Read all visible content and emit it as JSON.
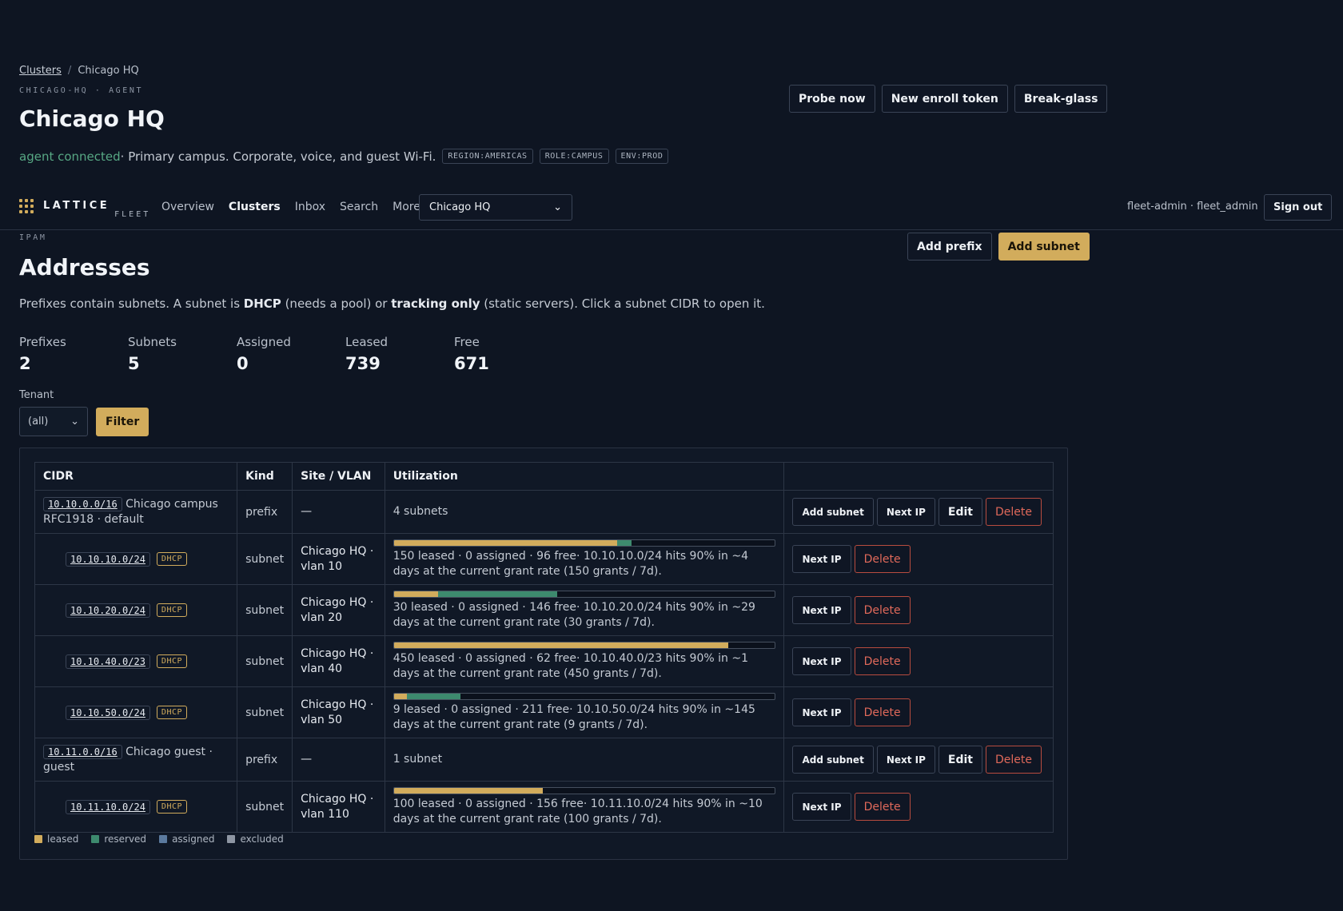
{
  "breadcrumb": {
    "root": "Clusters",
    "separator": "/",
    "current": "Chicago HQ"
  },
  "cluster": {
    "eyebrow": "CHICAGO-HQ · AGENT",
    "title": "Chicago HQ",
    "status": "agent connected",
    "description": " · Primary campus. Corporate, voice, and guest Wi-Fi.",
    "tags": [
      "REGION:AMERICAS",
      "ROLE:CAMPUS",
      "ENV:PROD"
    ],
    "actions": {
      "probe": "Probe now",
      "enroll": "New enroll token",
      "breakglass": "Break-glass"
    }
  },
  "nav": {
    "brand": "LATTICE",
    "brand_sub": "FLEET",
    "links": [
      "Overview",
      "Clusters",
      "Inbox",
      "Search",
      "More"
    ],
    "active_link": "Clusters",
    "cluster_select": "Chicago HQ",
    "user": "fleet-admin · fleet_admin",
    "signout": "Sign out"
  },
  "ipam": {
    "eyebrow": "IPAM",
    "title": "Addresses",
    "add_prefix": "Add prefix",
    "add_subnet": "Add subnet",
    "intro": {
      "t1": "Prefixes contain subnets. A subnet is ",
      "b1": "DHCP",
      "t2": " (needs a pool) or ",
      "b2": "tracking only",
      "t3": " (static servers). Click a subnet CIDR to open it."
    },
    "stats": [
      {
        "label": "Prefixes",
        "value": "2"
      },
      {
        "label": "Subnets",
        "value": "5"
      },
      {
        "label": "Assigned",
        "value": "0"
      },
      {
        "label": "Leased",
        "value": "739"
      },
      {
        "label": "Free",
        "value": "671"
      }
    ],
    "tenant_label": "Tenant",
    "tenant_value": "(all)",
    "filter_button": "Filter"
  },
  "table": {
    "headers": [
      "CIDR",
      "Kind",
      "Site / VLAN",
      "Utilization",
      ""
    ],
    "action_labels": {
      "add_subnet": "Add subnet",
      "next_ip": "Next IP",
      "edit": "Edit",
      "delete": "Delete"
    },
    "rows": [
      {
        "type": "prefix",
        "cidr": "10.10.0.0/16",
        "desc": " Chicago campus RFC1918 · default",
        "kind": "prefix",
        "site": "—",
        "util_text": "4 subnets"
      },
      {
        "type": "subnet",
        "cidr": "10.10.10.0/24",
        "badge": "DHCP",
        "kind": "subnet",
        "site": "Chicago HQ · vlan 10",
        "leased_frac": 0.586,
        "reserved_frac": 0.039,
        "util_text": "150 leased · 0 assigned · 96 free· 10.10.10.0/24 hits 90% in ~4 days at the current grant rate (150 grants / 7d)."
      },
      {
        "type": "subnet",
        "cidr": "10.10.20.0/24",
        "badge": "DHCP",
        "kind": "subnet",
        "site": "Chicago HQ · vlan 20",
        "leased_frac": 0.117,
        "reserved_frac": 0.313,
        "util_text": "30 leased · 0 assigned · 146 free· 10.10.20.0/24 hits 90% in ~29 days at the current grant rate (30 grants / 7d)."
      },
      {
        "type": "subnet",
        "cidr": "10.10.40.0/23",
        "badge": "DHCP",
        "kind": "subnet",
        "site": "Chicago HQ · vlan 40",
        "leased_frac": 0.879,
        "reserved_frac": 0.0,
        "util_text": "450 leased · 0 assigned · 62 free· 10.10.40.0/23 hits 90% in ~1 days at the current grant rate (450 grants / 7d)."
      },
      {
        "type": "subnet",
        "cidr": "10.10.50.0/24",
        "badge": "DHCP",
        "kind": "subnet",
        "site": "Chicago HQ · vlan 50",
        "leased_frac": 0.035,
        "reserved_frac": 0.141,
        "util_text": "9 leased · 0 assigned · 211 free· 10.10.50.0/24 hits 90% in ~145 days at the current grant rate (9 grants / 7d)."
      },
      {
        "type": "prefix",
        "cidr": "10.11.0.0/16",
        "desc": " Chicago guest · guest",
        "kind": "prefix",
        "site": "—",
        "util_text": "1 subnet"
      },
      {
        "type": "subnet",
        "cidr": "10.11.10.0/24",
        "badge": "DHCP",
        "kind": "subnet",
        "site": "Chicago HQ · vlan 110",
        "leased_frac": 0.391,
        "reserved_frac": 0.0,
        "util_text": "100 leased · 0 assigned · 156 free· 10.11.10.0/24 hits 90% in ~10 days at the current grant rate (100 grants / 7d)."
      }
    ]
  },
  "legend": [
    {
      "label": "leased",
      "color": "#d2ac5c"
    },
    {
      "label": "reserved",
      "color": "#3d8a6e"
    },
    {
      "label": "assigned",
      "color": "#5b7a9e"
    },
    {
      "label": "excluded",
      "color": "#8e96a3"
    }
  ],
  "colors": {
    "accent": "#d2ac5c",
    "connected": "#57a884",
    "danger": "#e0695a",
    "background": "#0e1522"
  }
}
